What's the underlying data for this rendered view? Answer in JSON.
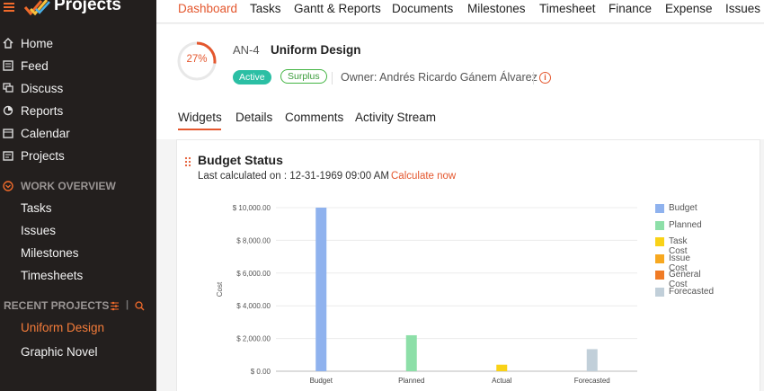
{
  "app": {
    "title": "Projects"
  },
  "sidebar": {
    "items": [
      {
        "label": "Home",
        "icon": "home-icon"
      },
      {
        "label": "Feed",
        "icon": "feed-icon"
      },
      {
        "label": "Discuss",
        "icon": "discuss-icon"
      },
      {
        "label": "Reports",
        "icon": "reports-icon"
      },
      {
        "label": "Calendar",
        "icon": "calendar-icon"
      },
      {
        "label": "Projects",
        "icon": "projects-icon"
      }
    ],
    "work_overview": {
      "label": "WORK OVERVIEW",
      "items": [
        "Tasks",
        "Issues",
        "Milestones",
        "Timesheets"
      ]
    },
    "recent_projects": {
      "label": "RECENT PROJECTS",
      "items": [
        "Uniform Design",
        "Graphic Novel"
      ]
    }
  },
  "topnav": {
    "tabs": [
      "Dashboard",
      "Tasks",
      "Gantt & Reports",
      "Documents",
      "Milestones",
      "Timesheet",
      "Finance",
      "Expense",
      "Issues"
    ]
  },
  "project": {
    "progress": "27%",
    "progress_value": 0.27,
    "key": "AN-4",
    "name": "Uniform Design",
    "status": "Active",
    "budget_badge": "Surplus",
    "owner": "Owner: Andrés Ricardo Gánem Álvarez"
  },
  "subtabs": [
    "Widgets",
    "Details",
    "Comments",
    "Activity Stream"
  ],
  "widget": {
    "title": "Budget Status",
    "calc_text": "Last calculated on : 12-31-1969 09:00 AM",
    "calc_link": "Calculate now"
  },
  "colors": {
    "accent": "#e4572e",
    "sidebar_bg": "#231f1e",
    "active_badge": "#2bbfa4",
    "surplus_badge": "#44b544"
  },
  "chart_data": {
    "type": "bar",
    "ylabel": "Cost",
    "ylim": [
      0,
      10000
    ],
    "yticks": [
      "$ 0.00",
      "$ 2,000.00",
      "$ 4,000.00",
      "$ 6,000.00",
      "$ 8,000.00",
      "$ 10,000.00"
    ],
    "categories": [
      "Budget",
      "Planned",
      "Actual",
      "Forecasted"
    ],
    "series": [
      {
        "name": "Budget",
        "color": "#8fb2ee",
        "values": [
          10000,
          null,
          null,
          null
        ]
      },
      {
        "name": "Planned",
        "color": "#8ddfa8",
        "values": [
          null,
          2200,
          null,
          null
        ]
      },
      {
        "name": "Task Cost",
        "color": "#f9d218",
        "values": [
          null,
          null,
          400,
          null
        ]
      },
      {
        "name": "Issue Cost",
        "color": "#f7a820",
        "values": [
          null,
          null,
          0,
          null
        ]
      },
      {
        "name": "General Cost",
        "color": "#f07b25",
        "values": [
          null,
          null,
          0,
          null
        ]
      },
      {
        "name": "Forecasted",
        "color": "#c1cfd9",
        "values": [
          null,
          null,
          null,
          1350
        ]
      }
    ],
    "legend_position": "right",
    "grid": true
  }
}
